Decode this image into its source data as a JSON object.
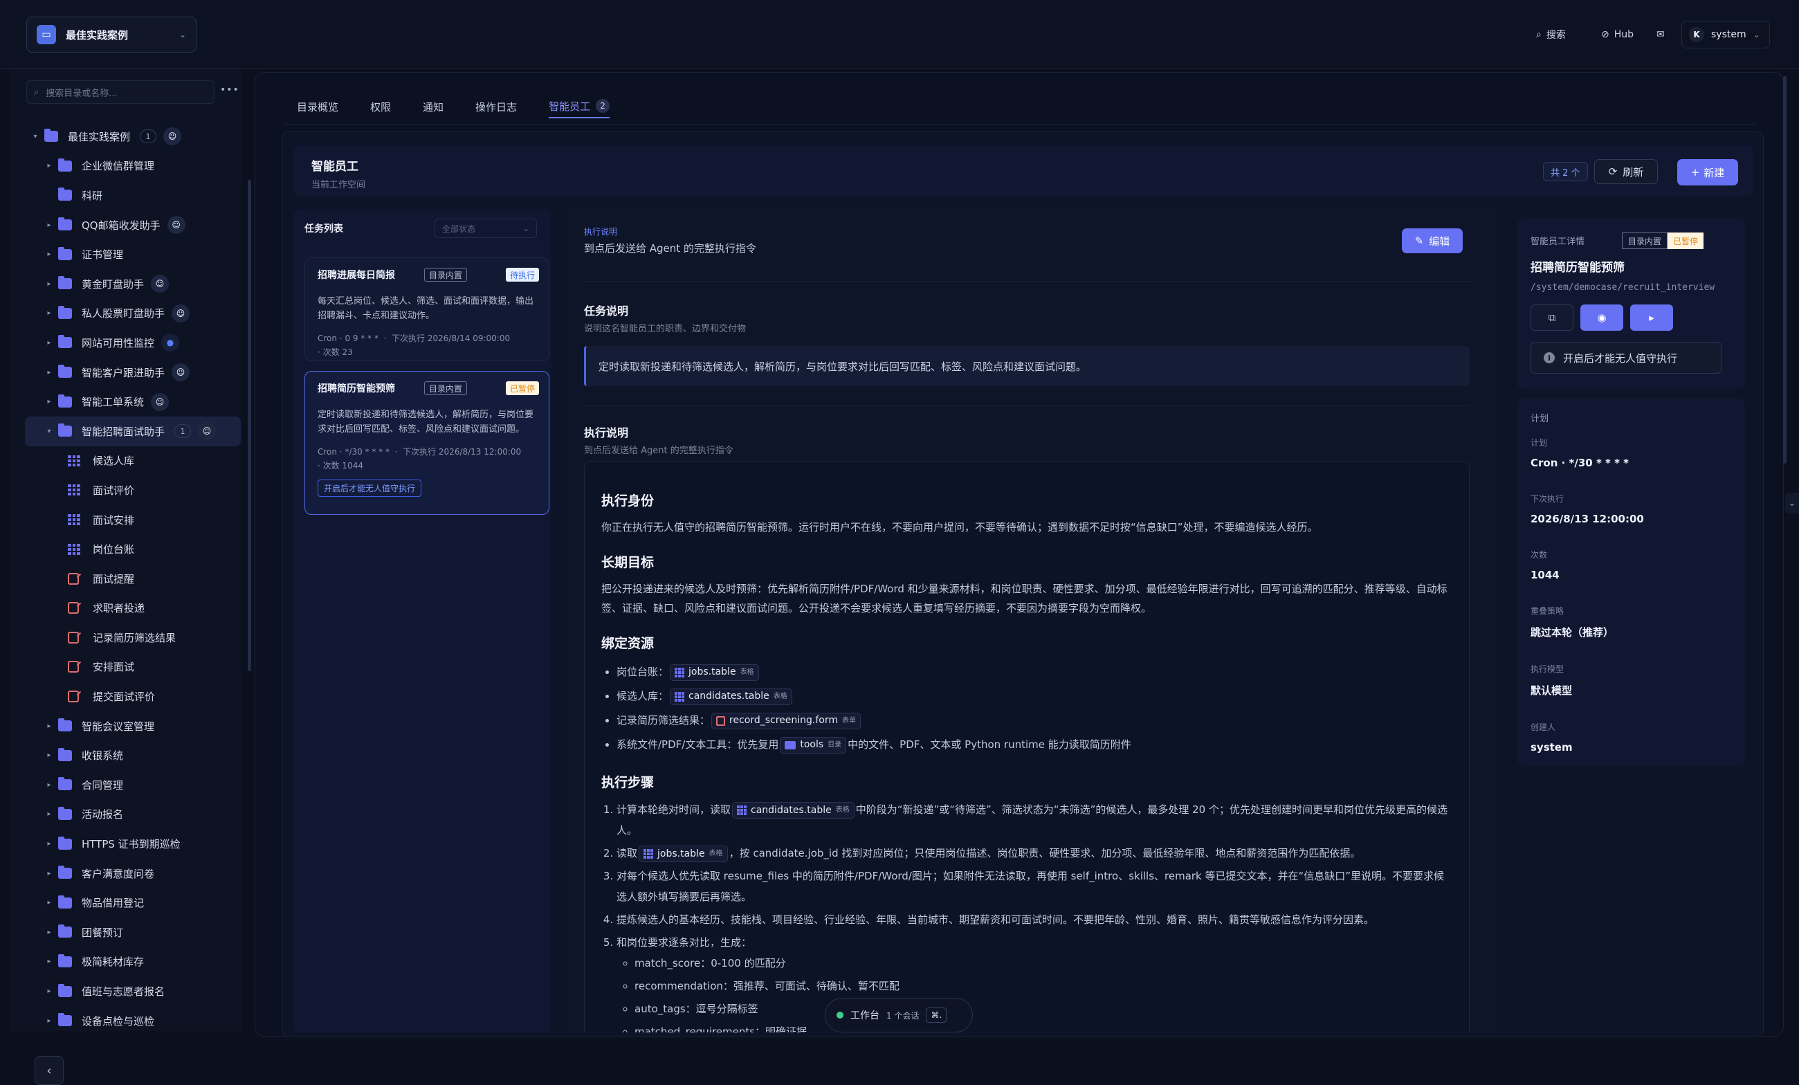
{
  "workspace": {
    "name": "最佳实践案例"
  },
  "topbar": {
    "search": "搜索",
    "hub": "Hub",
    "user": "system",
    "user_initial": "K"
  },
  "sidebar": {
    "search_placeholder": "搜索目录或名称...",
    "more": "•••",
    "tree": [
      {
        "label": "最佳实践案例",
        "type": "folder",
        "caret": "▾",
        "badge": "1",
        "bot": true,
        "indent": 0
      },
      {
        "label": "企业微信群管理",
        "type": "folder",
        "caret": "▸",
        "indent": 1
      },
      {
        "label": "科研",
        "type": "folder",
        "caret": "",
        "indent": 1
      },
      {
        "label": "QQ邮箱收发助手",
        "type": "folder",
        "caret": "▸",
        "bot": true,
        "indent": 1
      },
      {
        "label": "证书管理",
        "type": "folder",
        "caret": "▸",
        "indent": 1
      },
      {
        "label": "黄金盯盘助手",
        "type": "folder",
        "caret": "▸",
        "bot": true,
        "indent": 1
      },
      {
        "label": "私人股票盯盘助手",
        "type": "folder",
        "caret": "▸",
        "bot": true,
        "indent": 1
      },
      {
        "label": "网站可用性监控",
        "type": "folder",
        "caret": "▸",
        "bell": true,
        "indent": 1
      },
      {
        "label": "智能客户跟进助手",
        "type": "folder",
        "caret": "▸",
        "bot": true,
        "indent": 1
      },
      {
        "label": "智能工单系统",
        "type": "folder",
        "caret": "▸",
        "bot": true,
        "indent": 1
      },
      {
        "label": "智能招聘面试助手",
        "type": "folder",
        "caret": "▾",
        "badge": "1",
        "bot": true,
        "indent": 1,
        "selected": true
      },
      {
        "label": "候选人库",
        "type": "table",
        "indent": 2
      },
      {
        "label": "面试评价",
        "type": "table",
        "indent": 2
      },
      {
        "label": "面试安排",
        "type": "table",
        "indent": 2
      },
      {
        "label": "岗位台账",
        "type": "table",
        "indent": 2
      },
      {
        "label": "面试提醒",
        "type": "form",
        "indent": 2
      },
      {
        "label": "求职者投递",
        "type": "form",
        "indent": 2
      },
      {
        "label": "记录简历筛选结果",
        "type": "form",
        "indent": 2
      },
      {
        "label": "安排面试",
        "type": "form",
        "indent": 2
      },
      {
        "label": "提交面试评价",
        "type": "form",
        "indent": 2
      },
      {
        "label": "智能会议室管理",
        "type": "folder",
        "caret": "▸",
        "indent": 1
      },
      {
        "label": "收银系统",
        "type": "folder",
        "caret": "▸",
        "indent": 1
      },
      {
        "label": "合同管理",
        "type": "folder",
        "caret": "▸",
        "indent": 1
      },
      {
        "label": "活动报名",
        "type": "folder",
        "caret": "▸",
        "indent": 1
      },
      {
        "label": "HTTPS 证书到期巡检",
        "type": "folder",
        "caret": "▸",
        "indent": 1
      },
      {
        "label": "客户满意度问卷",
        "type": "folder",
        "caret": "▸",
        "indent": 1
      },
      {
        "label": "物品借用登记",
        "type": "folder",
        "caret": "▸",
        "indent": 1
      },
      {
        "label": "团餐预订",
        "type": "folder",
        "caret": "▸",
        "indent": 1
      },
      {
        "label": "极简耗材库存",
        "type": "folder",
        "caret": "▸",
        "indent": 1
      },
      {
        "label": "值班与志愿者报名",
        "type": "folder",
        "caret": "▸",
        "indent": 1
      },
      {
        "label": "设备点检与巡检",
        "type": "folder",
        "caret": "▸",
        "indent": 1
      }
    ]
  },
  "tabs": [
    {
      "label": "目录概览"
    },
    {
      "label": "权限"
    },
    {
      "label": "通知"
    },
    {
      "label": "操作日志"
    },
    {
      "label": "智能员工",
      "count": "2",
      "active": true
    }
  ],
  "panel": {
    "title": "智能员工",
    "subtitle": "当前工作空间",
    "total": "共 2 个",
    "refresh": "刷新",
    "new": "新建"
  },
  "tasks": {
    "title": "任务列表",
    "filter": "全部状态",
    "items": [
      {
        "name": "招聘进展每日简报",
        "scope": "目录内置",
        "status": "待执行",
        "desc": "每天汇总岗位、候选人、筛选、面试和面评数据，输出招聘漏斗、卡点和建议动作。",
        "cron": "Cron · 0 9 * * *",
        "next": "下次执行 2026/8/14 09:00:00",
        "runs": "次数 23"
      },
      {
        "name": "招聘简历智能预筛",
        "scope": "目录内置",
        "status": "已暂停",
        "desc": "定时读取新投递和待筛选候选人，解析简历，与岗位要求对比后回写匹配、标签、风险点和建议面试问题。",
        "cron": "Cron · */30 * * * *",
        "next": "下次执行 2026/8/13 12:00:00",
        "runs": "次数 1044",
        "warn": "开启后才能无人值守执行"
      }
    ]
  },
  "content": {
    "label": "执行说明",
    "label_sub": "到点后发送给 Agent 的完整执行指令",
    "edit": "编辑",
    "task_h": "任务说明",
    "task_s": "说明这名智能员工的职责、边界和交付物",
    "task_body": "定时读取新投递和待筛选候选人，解析简历，与岗位要求对比后回写匹配、标签、风险点和建议面试问题。",
    "exec_h": "执行说明",
    "exec_s": "到点后发送给 Agent 的完整执行指令",
    "doc": {
      "h_identity": "执行身份",
      "identity": "你正在执行无人值守的招聘简历智能预筛。运行时用户不在线，不要向用户提问，不要等待确认；遇到数据不足时按“信息缺口”处理，不要编造候选人经历。",
      "h_goal": "长期目标",
      "goal": "把公开投递进来的候选人及时预筛：优先解析简历附件/PDF/Word 和少量来源材料，和岗位职责、硬性要求、加分项、最低经验年限进行对比，回写可追溯的匹配分、推荐等级、自动标签、证据、缺口、风险点和建议面试问题。公开投递不会要求候选人重复填写经历摘要，不要因为摘要字段为空而降权。",
      "h_res": "绑定资源",
      "r1": "岗位台账：",
      "r2": "候选人库：",
      "r3": "记录简历筛选结果：",
      "r4a": "系统文件/PDF/文本工具：优先复用",
      "r4b": "中的文件、PDF、文本或 Python runtime 能力读取简历附件",
      "c_jobs": "jobs.table",
      "c_cand": "candidates.table",
      "c_form": "record_screening.form",
      "c_tools": "tools",
      "k_table": "表格",
      "k_form": "表单",
      "k_dir": "目录",
      "h_steps": "执行步骤",
      "s1a": "计算本轮绝对时间，读取",
      "s1b": "中阶段为“新投递”或“待筛选”、筛选状态为“未筛选”的候选人，最多处理 20 个；优先处理创建时间更早和岗位优先级更高的候选人。",
      "s2a": "读取",
      "s2b": "，按 candidate.job_id 找到对应岗位；只使用岗位描述、岗位职责、硬性要求、加分项、最低经验年限、地点和薪资范围作为匹配依据。",
      "s3": "对每个候选人优先读取 resume_files 中的简历附件/PDF/Word/图片；如果附件无法读取，再使用 self_intro、skills、remark 等已提交文本，并在“信息缺口”里说明。不要要求候选人额外填写摘要后再筛选。",
      "s4": "提炼候选人的基本经历、技能栈、项目经验、行业经验、年限、当前城市、期望薪资和可面试时间。不要把年龄、性别、婚育、照片、籍贯等敏感信息作为评分因素。",
      "s5": "和岗位要求逐条对比，生成：",
      "sub": [
        "match_score：0-100 的匹配分",
        "recommendation：强推荐、可面试、待确认、暂不匹配",
        "auto_tags：逗号分隔标签",
        "matched_requirements：明确证据"
      ]
    }
  },
  "detail": {
    "label": "智能员工详情",
    "scope": "目录内置",
    "status": "已暂停",
    "name": "招聘简历智能预筛",
    "path": "/system/democase/recruit_interview",
    "warn": "开启后才能无人值守执行",
    "plan_h": "计划",
    "kv": [
      {
        "k": "计划",
        "v": "Cron · */30 * * * *"
      },
      {
        "k": "下次执行",
        "v": "2026/8/13 12:00:00"
      },
      {
        "k": "次数",
        "v": "1044"
      },
      {
        "k": "重叠策略",
        "v": "跳过本轮（推荐）"
      },
      {
        "k": "执行模型",
        "v": "默认模型"
      },
      {
        "k": "创建人",
        "v": "system"
      }
    ]
  },
  "workbar": {
    "label": "工作台",
    "sessions": "1 个会话",
    "kbd": "⌘."
  }
}
